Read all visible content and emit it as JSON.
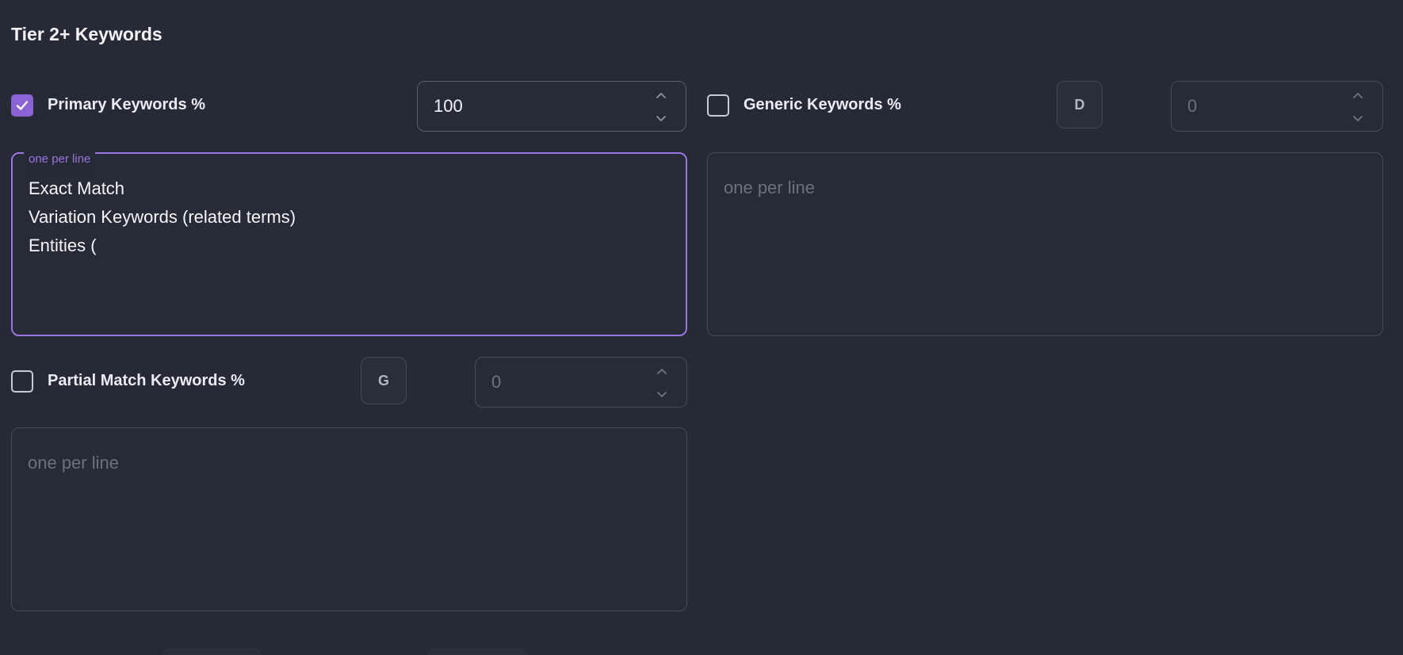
{
  "section": {
    "title": "Tier 2+ Keywords"
  },
  "primary": {
    "checked": true,
    "label": "Primary Keywords %",
    "value": "100",
    "legend": "one per line",
    "lines": [
      "Exact Match",
      "Variation Keywords (related terms)",
      "Entities ("
    ]
  },
  "generic": {
    "checked": false,
    "label": "Generic Keywords %",
    "badge": "D",
    "value": "0",
    "placeholder": "one per line"
  },
  "partial": {
    "checked": false,
    "label": "Partial Match Keywords %",
    "badge": "G",
    "value": "0",
    "placeholder": "one per line"
  },
  "colors": {
    "accent": "#8b63d4",
    "focus_border": "#9b74de",
    "background": "#252a36"
  }
}
